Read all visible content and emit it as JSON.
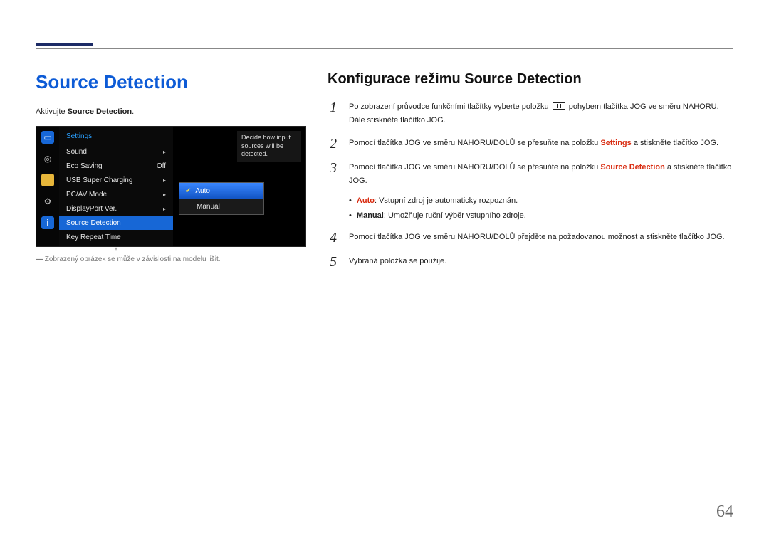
{
  "page_number": "64",
  "left": {
    "title": "Source Detection",
    "activate_prefix": "Aktivujte ",
    "activate_bold": "Source Detection",
    "activate_suffix": ".",
    "footnote_dash": "―",
    "footnote": " Zobrazený obrázek se může v závislosti na modelu lišit."
  },
  "osd": {
    "header": "Settings",
    "items": [
      {
        "label": "Sound",
        "value": "",
        "arrow": true
      },
      {
        "label": "Eco Saving",
        "value": "Off",
        "arrow": false
      },
      {
        "label": "USB Super Charging",
        "value": "",
        "arrow": true
      },
      {
        "label": "PC/AV Mode",
        "value": "",
        "arrow": true
      },
      {
        "label": "DisplayPort Ver.",
        "value": "",
        "arrow": true
      },
      {
        "label": "Source Detection",
        "value": "",
        "arrow": false,
        "selected": true
      },
      {
        "label": "Key Repeat Time",
        "value": "",
        "arrow": false
      }
    ],
    "submenu": [
      {
        "label": "Auto",
        "selected": true
      },
      {
        "label": "Manual",
        "selected": false
      }
    ],
    "tooltip": "Decide how input sources will be detected."
  },
  "right": {
    "title": "Konfigurace režimu Source Detection",
    "step1_a": "Po zobrazení průvodce funkčními tlačítky vyberte položku ",
    "step1_b": " pohybem tlačítka JOG ve směru NAHORU. Dále stiskněte tlačítko JOG.",
    "step2_a": "Pomocí tlačítka JOG ve směru NAHORU/DOLŮ se přesuňte na položku ",
    "step2_hl": "Settings",
    "step2_b": " a stiskněte tlačítko JOG.",
    "step3_a": "Pomocí tlačítka JOG ve směru NAHORU/DOLŮ se přesuňte na položku ",
    "step3_hl": "Source Detection",
    "step3_b": " a stiskněte tlačítko JOG.",
    "bullet_auto_hl": "Auto",
    "bullet_auto_txt": ": Vstupní zdroj je automaticky rozpoznán.",
    "bullet_manual_b": "Manual",
    "bullet_manual_txt": ": Umožňuje ruční výběr vstupního zdroje.",
    "step4": "Pomocí tlačítka JOG ve směru NAHORU/DOLŮ přejděte na požadovanou možnost a stiskněte tlačítko JOG.",
    "step5": "Vybraná položka se použije."
  }
}
